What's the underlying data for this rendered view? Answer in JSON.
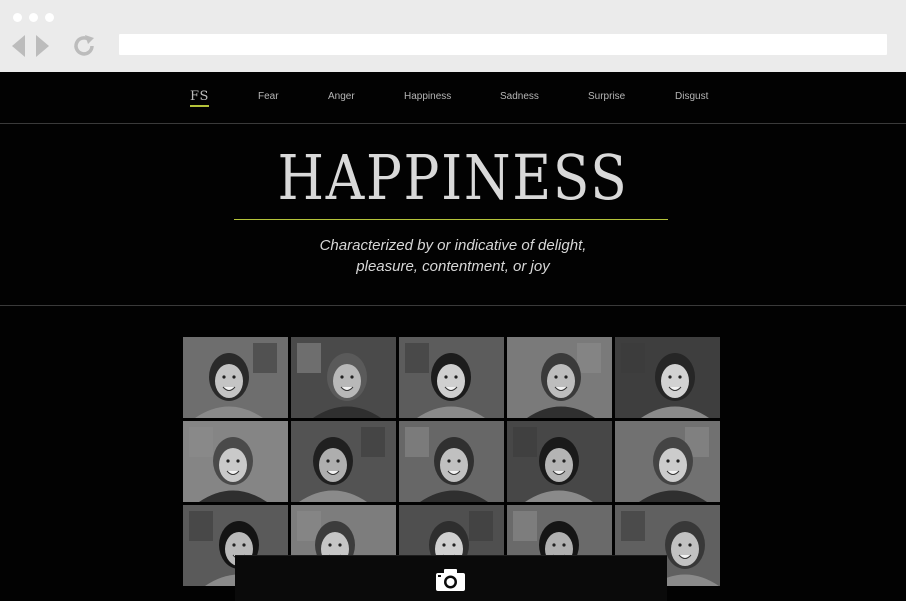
{
  "browser": {
    "back_icon": "triangle-left-icon",
    "forward_icon": "triangle-right-icon",
    "reload_icon": "reload-icon",
    "url": ""
  },
  "nav": {
    "logo": "FS",
    "items": [
      "Fear",
      "Anger",
      "Happiness",
      "Sadness",
      "Surprise",
      "Disgust"
    ]
  },
  "hero": {
    "title": "HAPPINESS",
    "description_line1": "Characterized by or indicative of delight,",
    "description_line2": "pleasure, contentment, or joy"
  },
  "photos": {
    "count": 15,
    "caption": ""
  },
  "camera": {
    "icon": "camera-icon"
  },
  "colors": {
    "accent": "#b4c33a",
    "page_background": "#020202",
    "chrome_background": "#ebebeb",
    "text_light": "#d9d9d9"
  }
}
